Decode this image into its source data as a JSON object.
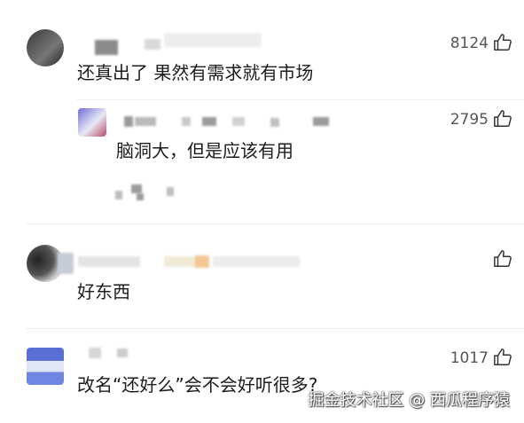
{
  "comments": [
    {
      "text": "还真出了 果然有需求就有市场",
      "likes": "8124"
    },
    {
      "text": "脑洞大，但是应该有用",
      "likes": "2795"
    },
    {
      "text": "好东西",
      "likes": ""
    },
    {
      "text": "改名“还好么”会不会好听很多?",
      "likes": "1017"
    }
  ],
  "watermark": "掘金技术社区 @ 西瓜程序猿",
  "icons": {
    "like": "thumbs-up-icon"
  }
}
